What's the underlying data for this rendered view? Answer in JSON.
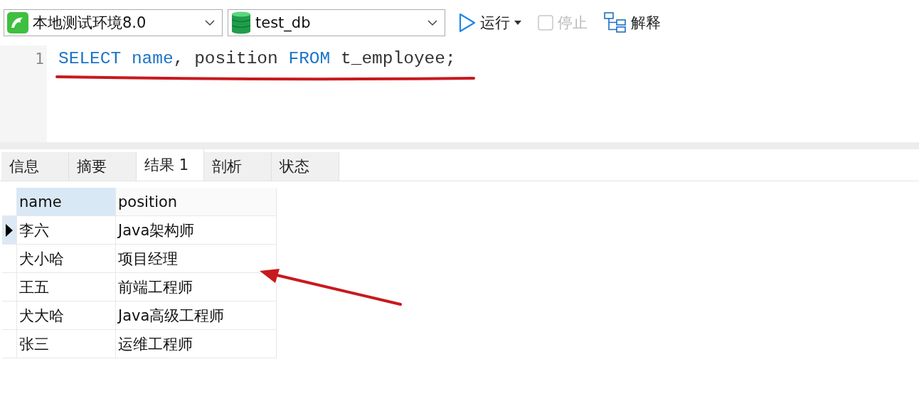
{
  "toolbar": {
    "connection": {
      "value": "本地测试环境8.0"
    },
    "database": {
      "value": "test_db"
    },
    "run_button": {
      "label": "运行"
    },
    "stop_button": {
      "label": "停止",
      "disabled": true
    },
    "explain_button": {
      "label": "解释"
    }
  },
  "editor": {
    "lines": [
      {
        "number": "1",
        "tokens": [
          {
            "text": "SELECT name",
            "kind": "keyword"
          },
          {
            "text": ", position ",
            "kind": "plain"
          },
          {
            "text": "FROM",
            "kind": "keyword"
          },
          {
            "text": " t_employee;",
            "kind": "plain"
          }
        ]
      }
    ]
  },
  "tabs": [
    {
      "label": "信息",
      "selected": false
    },
    {
      "label": "摘要",
      "selected": false
    },
    {
      "label": "结果 1",
      "selected": true
    },
    {
      "label": "剖析",
      "selected": false
    },
    {
      "label": "状态",
      "selected": false
    }
  ],
  "grid": {
    "columns": [
      {
        "label": "name",
        "selected": true
      },
      {
        "label": "position",
        "selected": false
      }
    ],
    "rows": [
      {
        "current": true,
        "cells": [
          "李六",
          "Java架构师"
        ]
      },
      {
        "current": false,
        "cells": [
          "犬小哈",
          "项目经理"
        ]
      },
      {
        "current": false,
        "cells": [
          "王五",
          "前端工程师"
        ]
      },
      {
        "current": false,
        "cells": [
          "犬大哈",
          "Java高级工程师"
        ]
      },
      {
        "current": false,
        "cells": [
          "张三",
          "运维工程师"
        ]
      }
    ]
  }
}
